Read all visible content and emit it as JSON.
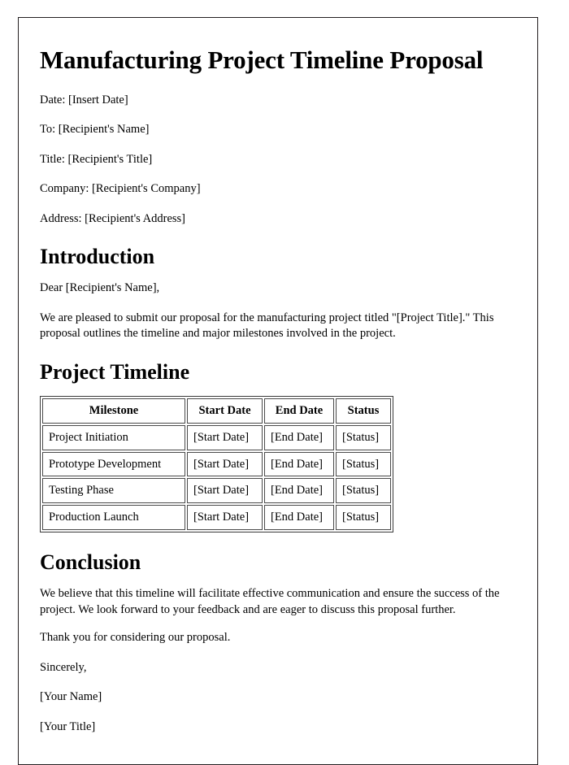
{
  "document": {
    "title": "Manufacturing Project Timeline Proposal",
    "meta": [
      "Date: [Insert Date]",
      "To: [Recipient's Name]",
      "Title: [Recipient's Title]",
      "Company: [Recipient's Company]",
      "Address: [Recipient's Address]"
    ],
    "introduction": {
      "heading": "Introduction",
      "salutation": "Dear [Recipient's Name],",
      "paragraph": "We are pleased to submit our proposal for the manufacturing project titled \"[Project Title].\" This proposal outlines the timeline and major milestones involved in the project."
    },
    "timeline": {
      "heading": "Project Timeline",
      "columns": [
        "Milestone",
        "Start Date",
        "End Date",
        "Status"
      ],
      "rows": [
        [
          "Project Initiation",
          "[Start Date]",
          "[End Date]",
          "[Status]"
        ],
        [
          "Prototype Development",
          "[Start Date]",
          "[End Date]",
          "[Status]"
        ],
        [
          "Testing Phase",
          "[Start Date]",
          "[End Date]",
          "[Status]"
        ],
        [
          "Production Launch",
          "[Start Date]",
          "[End Date]",
          "[Status]"
        ]
      ]
    },
    "conclusion": {
      "heading": "Conclusion",
      "paragraph": "We believe that this timeline will facilitate effective communication and ensure the success of the project. We look forward to your feedback and are eager to discuss this proposal further.",
      "thanks": "Thank you for considering our proposal."
    },
    "signature": {
      "closing": "Sincerely,",
      "name": "[Your Name]",
      "title": "[Your Title]"
    }
  }
}
